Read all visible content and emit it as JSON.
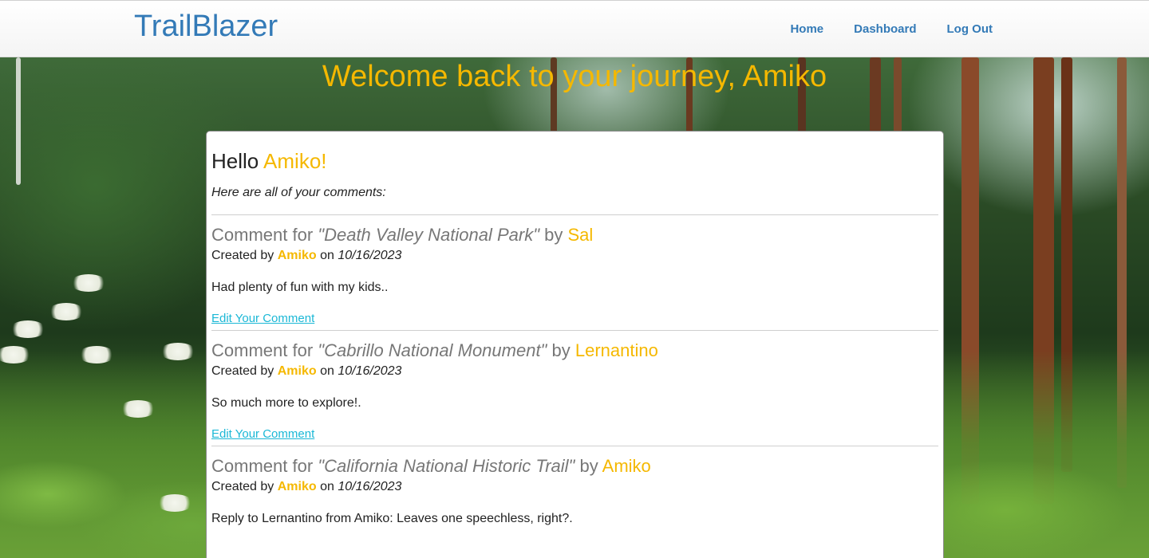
{
  "navbar": {
    "brand": "TrailBlazer",
    "links": [
      {
        "label": "Home"
      },
      {
        "label": "Dashboard"
      },
      {
        "label": "Log Out"
      }
    ]
  },
  "welcome": {
    "text": "Welcome back to your journey, Amiko"
  },
  "card": {
    "greeting": "Hello",
    "user_name": "Amiko!",
    "intro": "Here are all of your comments:",
    "comment_prefix": "Comment for",
    "by_word": "by",
    "created_by_word": "Created by",
    "on_word": "on",
    "edit_label": "Edit Your Comment",
    "comments": [
      {
        "place": "\"Death Valley National Park\"",
        "place_author": "Sal",
        "created_by": "Amiko",
        "date": "10/16/2023",
        "body": "Had plenty of fun with my kids.."
      },
      {
        "place": "\"Cabrillo National Monument\"",
        "place_author": "Lernantino",
        "created_by": "Amiko",
        "date": "10/16/2023",
        "body": "So much more to explore!."
      },
      {
        "place": "\"California National Historic Trail\"",
        "place_author": "Amiko",
        "created_by": "Amiko",
        "date": "10/16/2023",
        "body": "Reply to Lernantino from Amiko: Leaves one speechless, right?."
      }
    ]
  },
  "colors": {
    "brand": "#337ab7",
    "accent": "#f5b800",
    "link": "#1bb8d6",
    "muted": "#777777"
  }
}
